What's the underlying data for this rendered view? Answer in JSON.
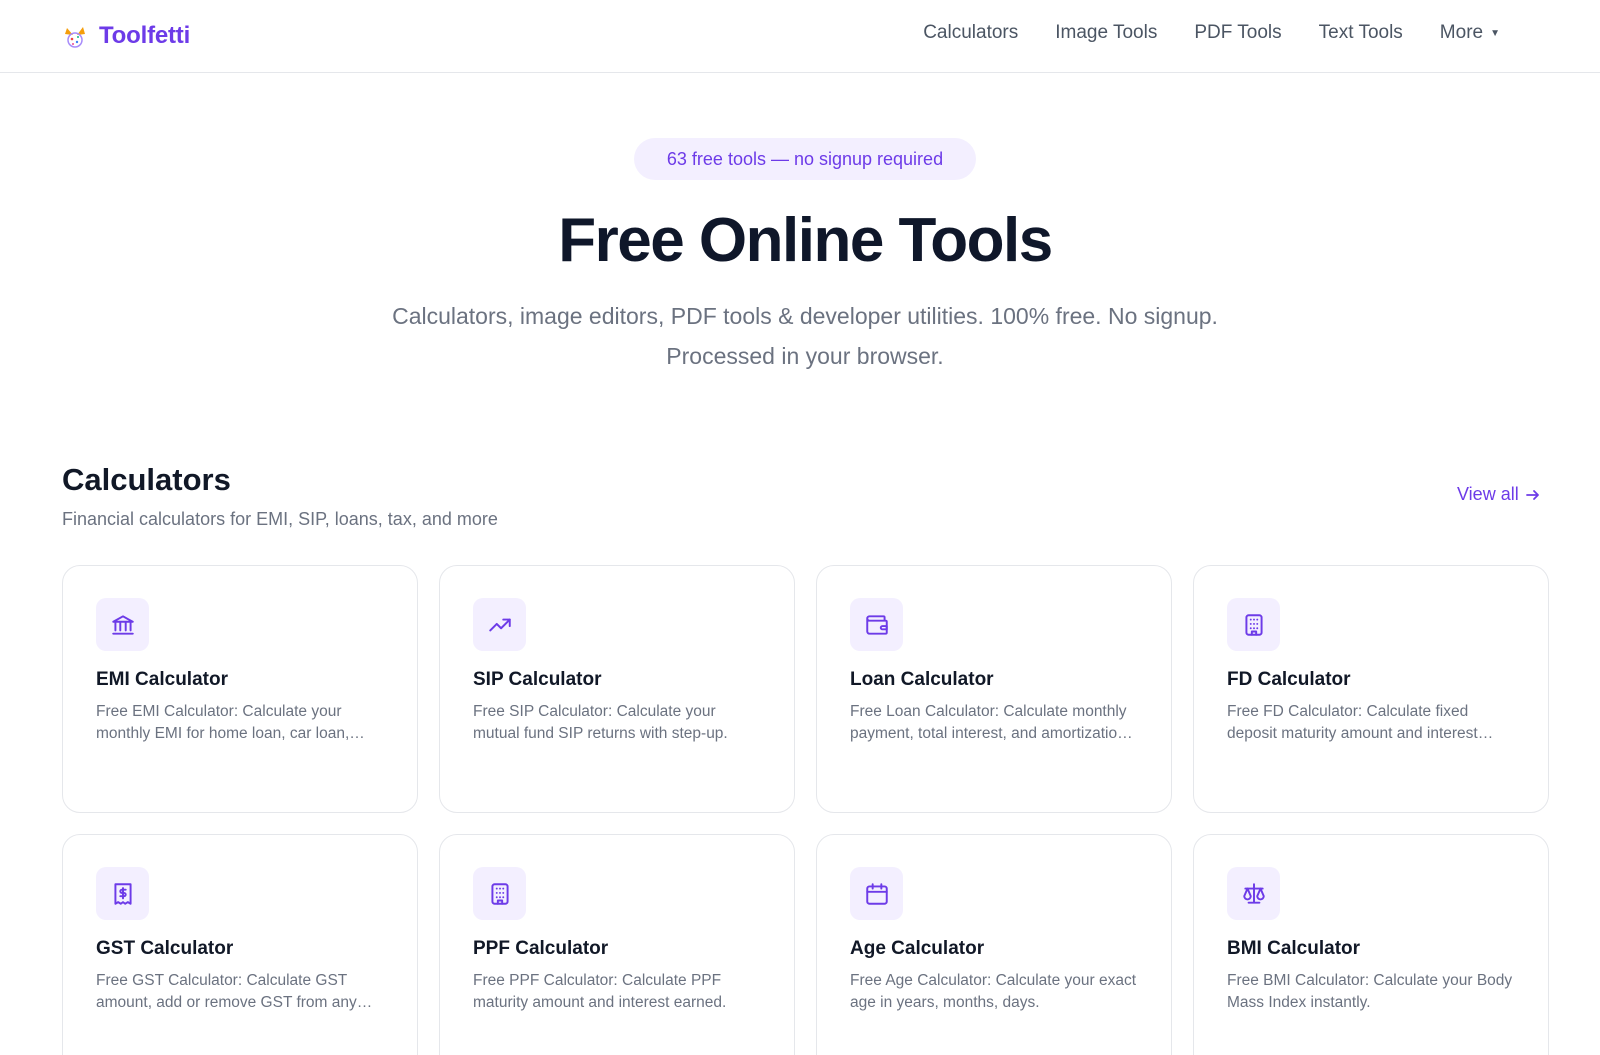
{
  "brand": {
    "name": "Toolfetti",
    "color": "#6d3be8"
  },
  "nav": {
    "items": [
      {
        "label": "Calculators"
      },
      {
        "label": "Image Tools"
      },
      {
        "label": "PDF Tools"
      },
      {
        "label": "Text Tools"
      }
    ],
    "more_label": "More"
  },
  "hero": {
    "badge": "63 free tools — no signup required",
    "title": "Free Online Tools",
    "subtitle": "Calculators, image editors, PDF tools & developer utilities. 100% free. No signup. Processed in your browser."
  },
  "section": {
    "title": "Calculators",
    "subtitle": "Financial calculators for EMI, SIP, loans, tax, and more",
    "view_all": "View all",
    "cards": [
      {
        "icon": "bank-icon",
        "title": "EMI Calculator",
        "desc": "Free EMI Calculator: Calculate your monthly EMI for home loan, car loan, personal loan and more."
      },
      {
        "icon": "trending-up-icon",
        "title": "SIP Calculator",
        "desc": "Free SIP Calculator: Calculate your mutual fund SIP returns with step-up."
      },
      {
        "icon": "wallet-icon",
        "title": "Loan Calculator",
        "desc": "Free Loan Calculator: Calculate monthly payment, total interest, and amortization schedule."
      },
      {
        "icon": "building-icon",
        "title": "FD Calculator",
        "desc": "Free FD Calculator: Calculate fixed deposit maturity amount and interest earned."
      },
      {
        "icon": "receipt-icon",
        "title": "GST Calculator",
        "desc": "Free GST Calculator: Calculate GST amount, add or remove GST from any amount."
      },
      {
        "icon": "building-icon",
        "title": "PPF Calculator",
        "desc": "Free PPF Calculator: Calculate PPF maturity amount and interest earned."
      },
      {
        "icon": "calendar-icon",
        "title": "Age Calculator",
        "desc": "Free Age Calculator: Calculate your exact age in years, months, days."
      },
      {
        "icon": "scale-icon",
        "title": "BMI Calculator",
        "desc": "Free BMI Calculator: Calculate your Body Mass Index instantly."
      }
    ]
  },
  "colors": {
    "accent": "#6d3be8",
    "accent_bg": "#f3efff",
    "text": "#111827",
    "muted": "#6b7280",
    "border": "#e5e7eb"
  }
}
